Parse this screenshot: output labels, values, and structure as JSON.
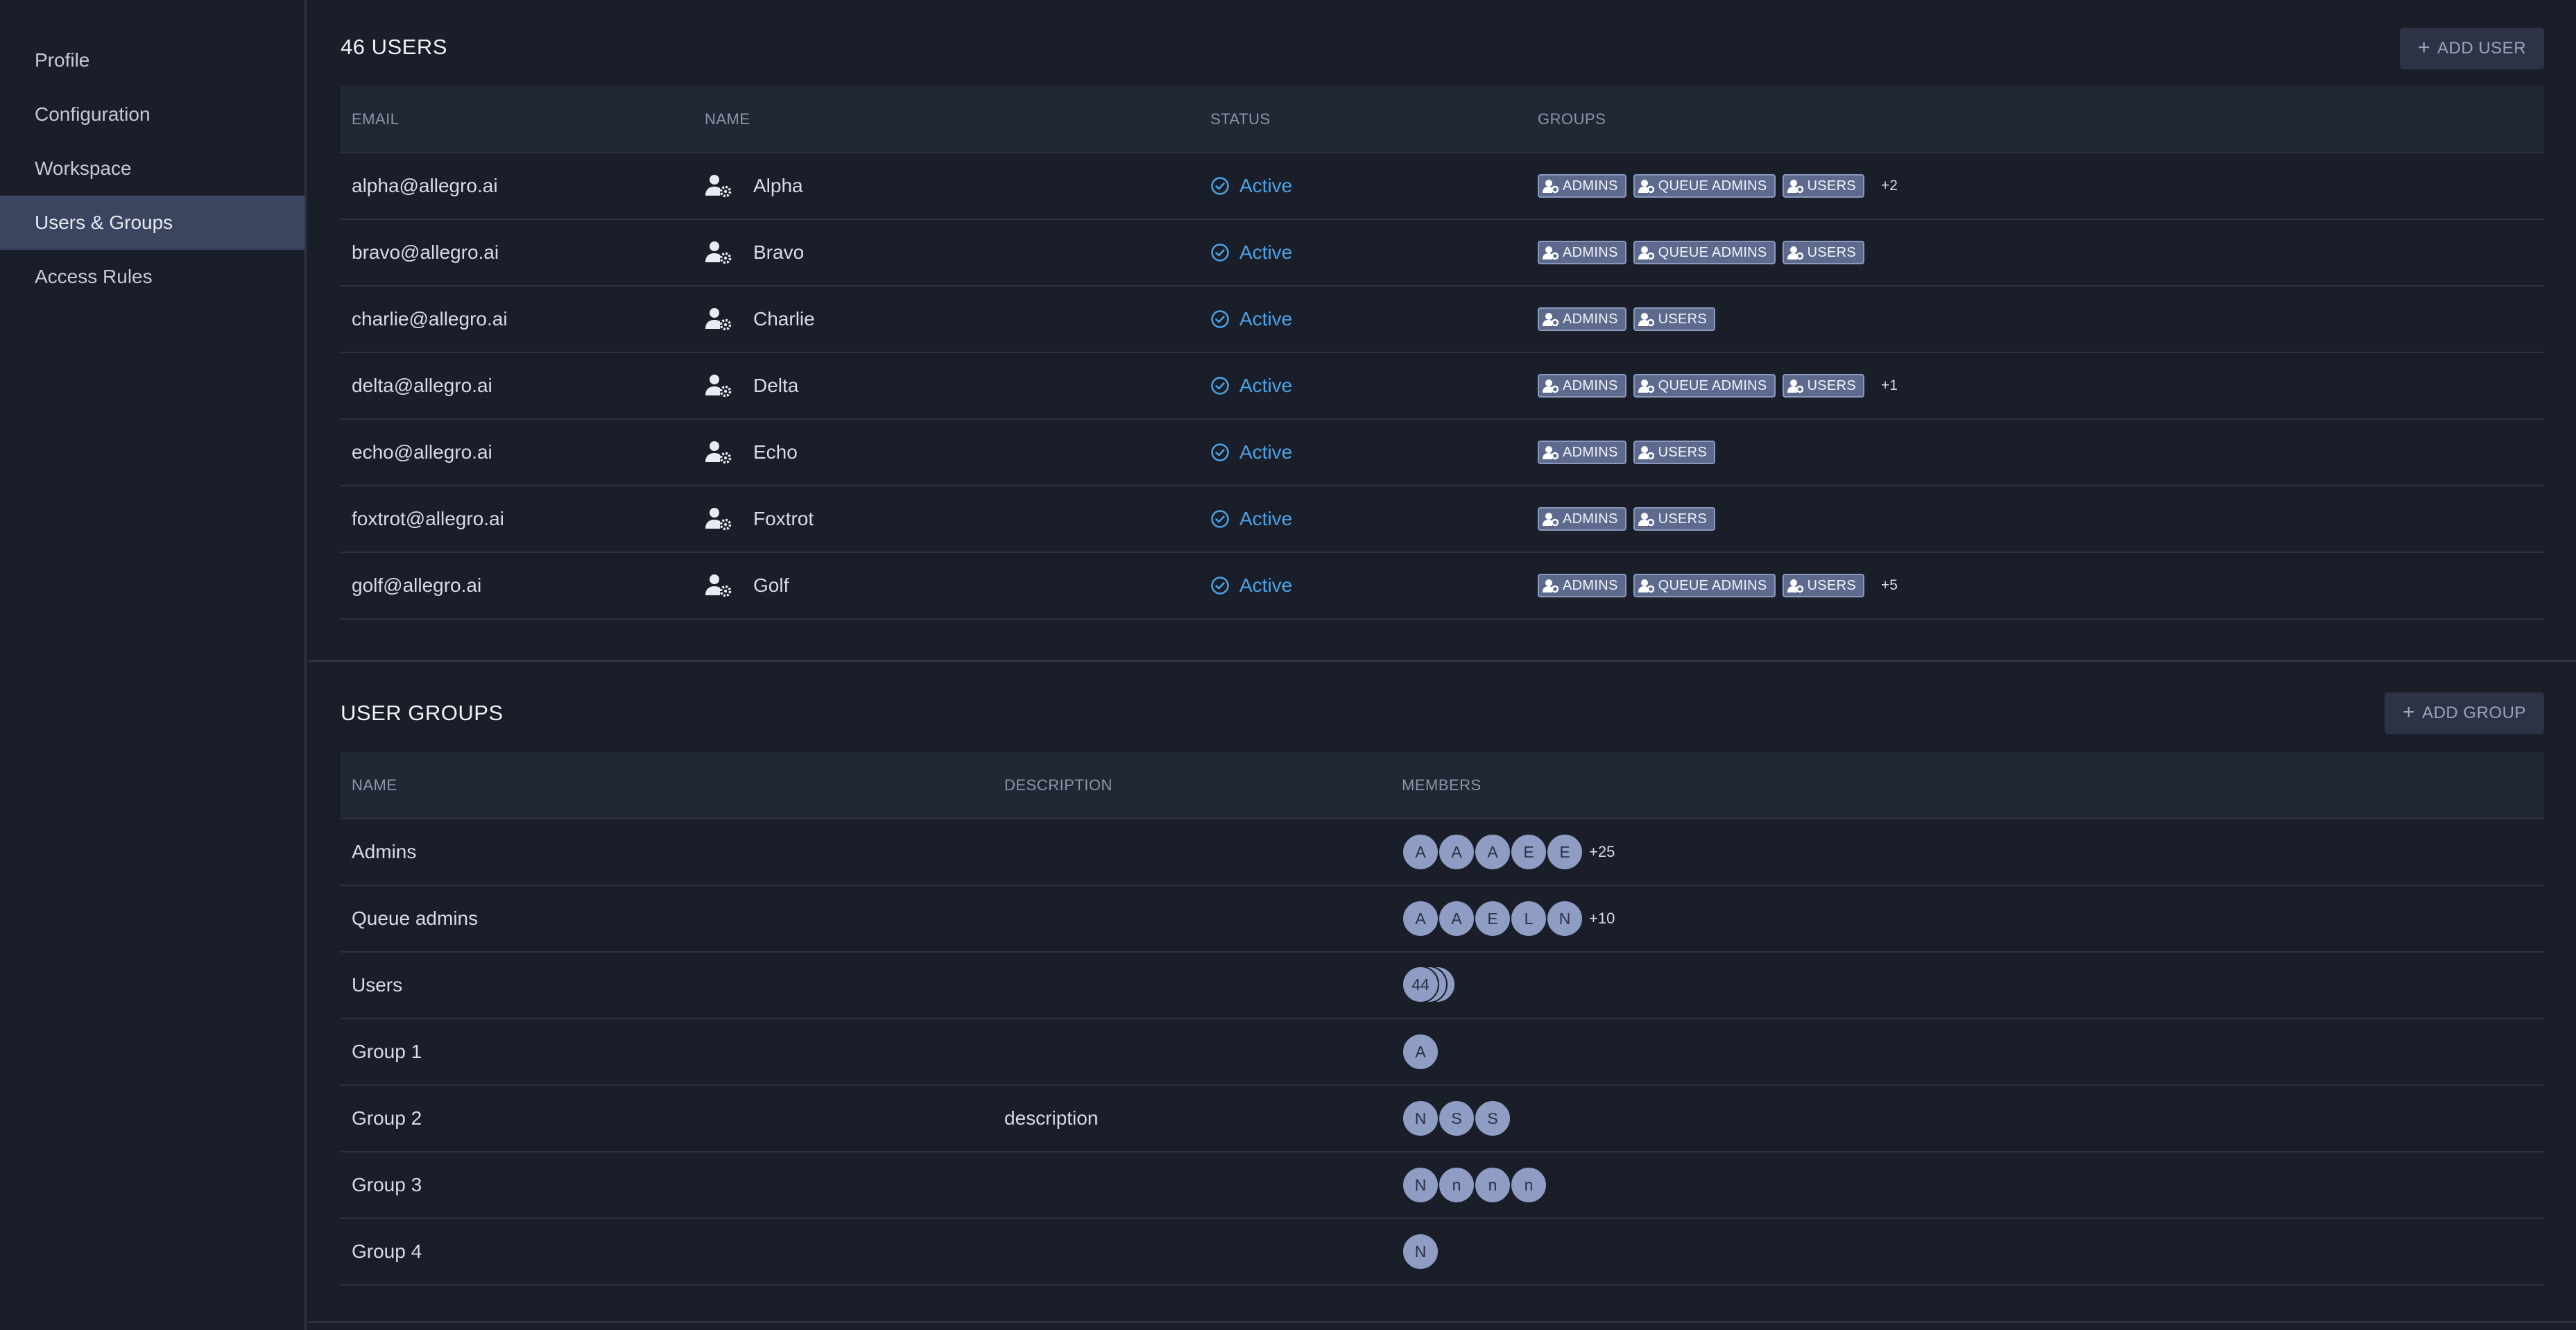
{
  "sidebar": {
    "items": [
      {
        "label": "Profile",
        "active": false
      },
      {
        "label": "Configuration",
        "active": false
      },
      {
        "label": "Workspace",
        "active": false
      },
      {
        "label": "Users & Groups",
        "active": true
      },
      {
        "label": "Access Rules",
        "active": false
      }
    ]
  },
  "users": {
    "title": "46 USERS",
    "add_label": "ADD USER",
    "columns": {
      "email": "EMAIL",
      "name": "NAME",
      "status": "STATUS",
      "groups": "GROUPS"
    },
    "rows": [
      {
        "email": "alpha@allegro.ai",
        "name": "Alpha",
        "status": "Active",
        "groups": [
          "ADMINS",
          "QUEUE ADMINS",
          "USERS"
        ],
        "more": "+2"
      },
      {
        "email": "bravo@allegro.ai",
        "name": "Bravo",
        "status": "Active",
        "groups": [
          "ADMINS",
          "QUEUE ADMINS",
          "USERS"
        ],
        "more": ""
      },
      {
        "email": "charlie@allegro.ai",
        "name": "Charlie",
        "status": "Active",
        "groups": [
          "ADMINS",
          "USERS"
        ],
        "more": ""
      },
      {
        "email": "delta@allegro.ai",
        "name": "Delta",
        "status": "Active",
        "groups": [
          "ADMINS",
          "QUEUE ADMINS",
          "USERS"
        ],
        "more": "+1"
      },
      {
        "email": "echo@allegro.ai",
        "name": "Echo",
        "status": "Active",
        "groups": [
          "ADMINS",
          "USERS"
        ],
        "more": ""
      },
      {
        "email": "foxtrot@allegro.ai",
        "name": "Foxtrot",
        "status": "Active",
        "groups": [
          "ADMINS",
          "USERS"
        ],
        "more": ""
      },
      {
        "email": "golf@allegro.ai",
        "name": "Golf",
        "status": "Active",
        "groups": [
          "ADMINS",
          "QUEUE ADMINS",
          "USERS"
        ],
        "more": "+5"
      }
    ]
  },
  "groups": {
    "title": "USER GROUPS",
    "add_label": "ADD GROUP",
    "columns": {
      "name": "NAME",
      "description": "DESCRIPTION",
      "members": "MEMBERS"
    },
    "rows": [
      {
        "name": "Admins",
        "description": "",
        "members": [
          "A",
          "A",
          "A",
          "E",
          "E"
        ],
        "more": "+25",
        "stack": false
      },
      {
        "name": "Queue admins",
        "description": "",
        "members": [
          "A",
          "A",
          "E",
          "L",
          "N"
        ],
        "more": "+10",
        "stack": false
      },
      {
        "name": "Users",
        "description": "",
        "members": [
          "44"
        ],
        "more": "",
        "stack": true
      },
      {
        "name": "Group 1",
        "description": "",
        "members": [
          "A"
        ],
        "more": "",
        "stack": false
      },
      {
        "name": "Group 2",
        "description": "description",
        "members": [
          "N",
          "S",
          "S"
        ],
        "more": "",
        "stack": false
      },
      {
        "name": "Group 3",
        "description": "",
        "members": [
          "N",
          "n",
          "n",
          "n"
        ],
        "more": "",
        "stack": false
      },
      {
        "name": "Group 4",
        "description": "",
        "members": [
          "N"
        ],
        "more": "",
        "stack": false
      }
    ]
  },
  "colors": {
    "accent": "#4aa3e6",
    "active_nav": "#3b4560",
    "tag": "#5d6a8e",
    "avatar": "#8f9cc3"
  }
}
